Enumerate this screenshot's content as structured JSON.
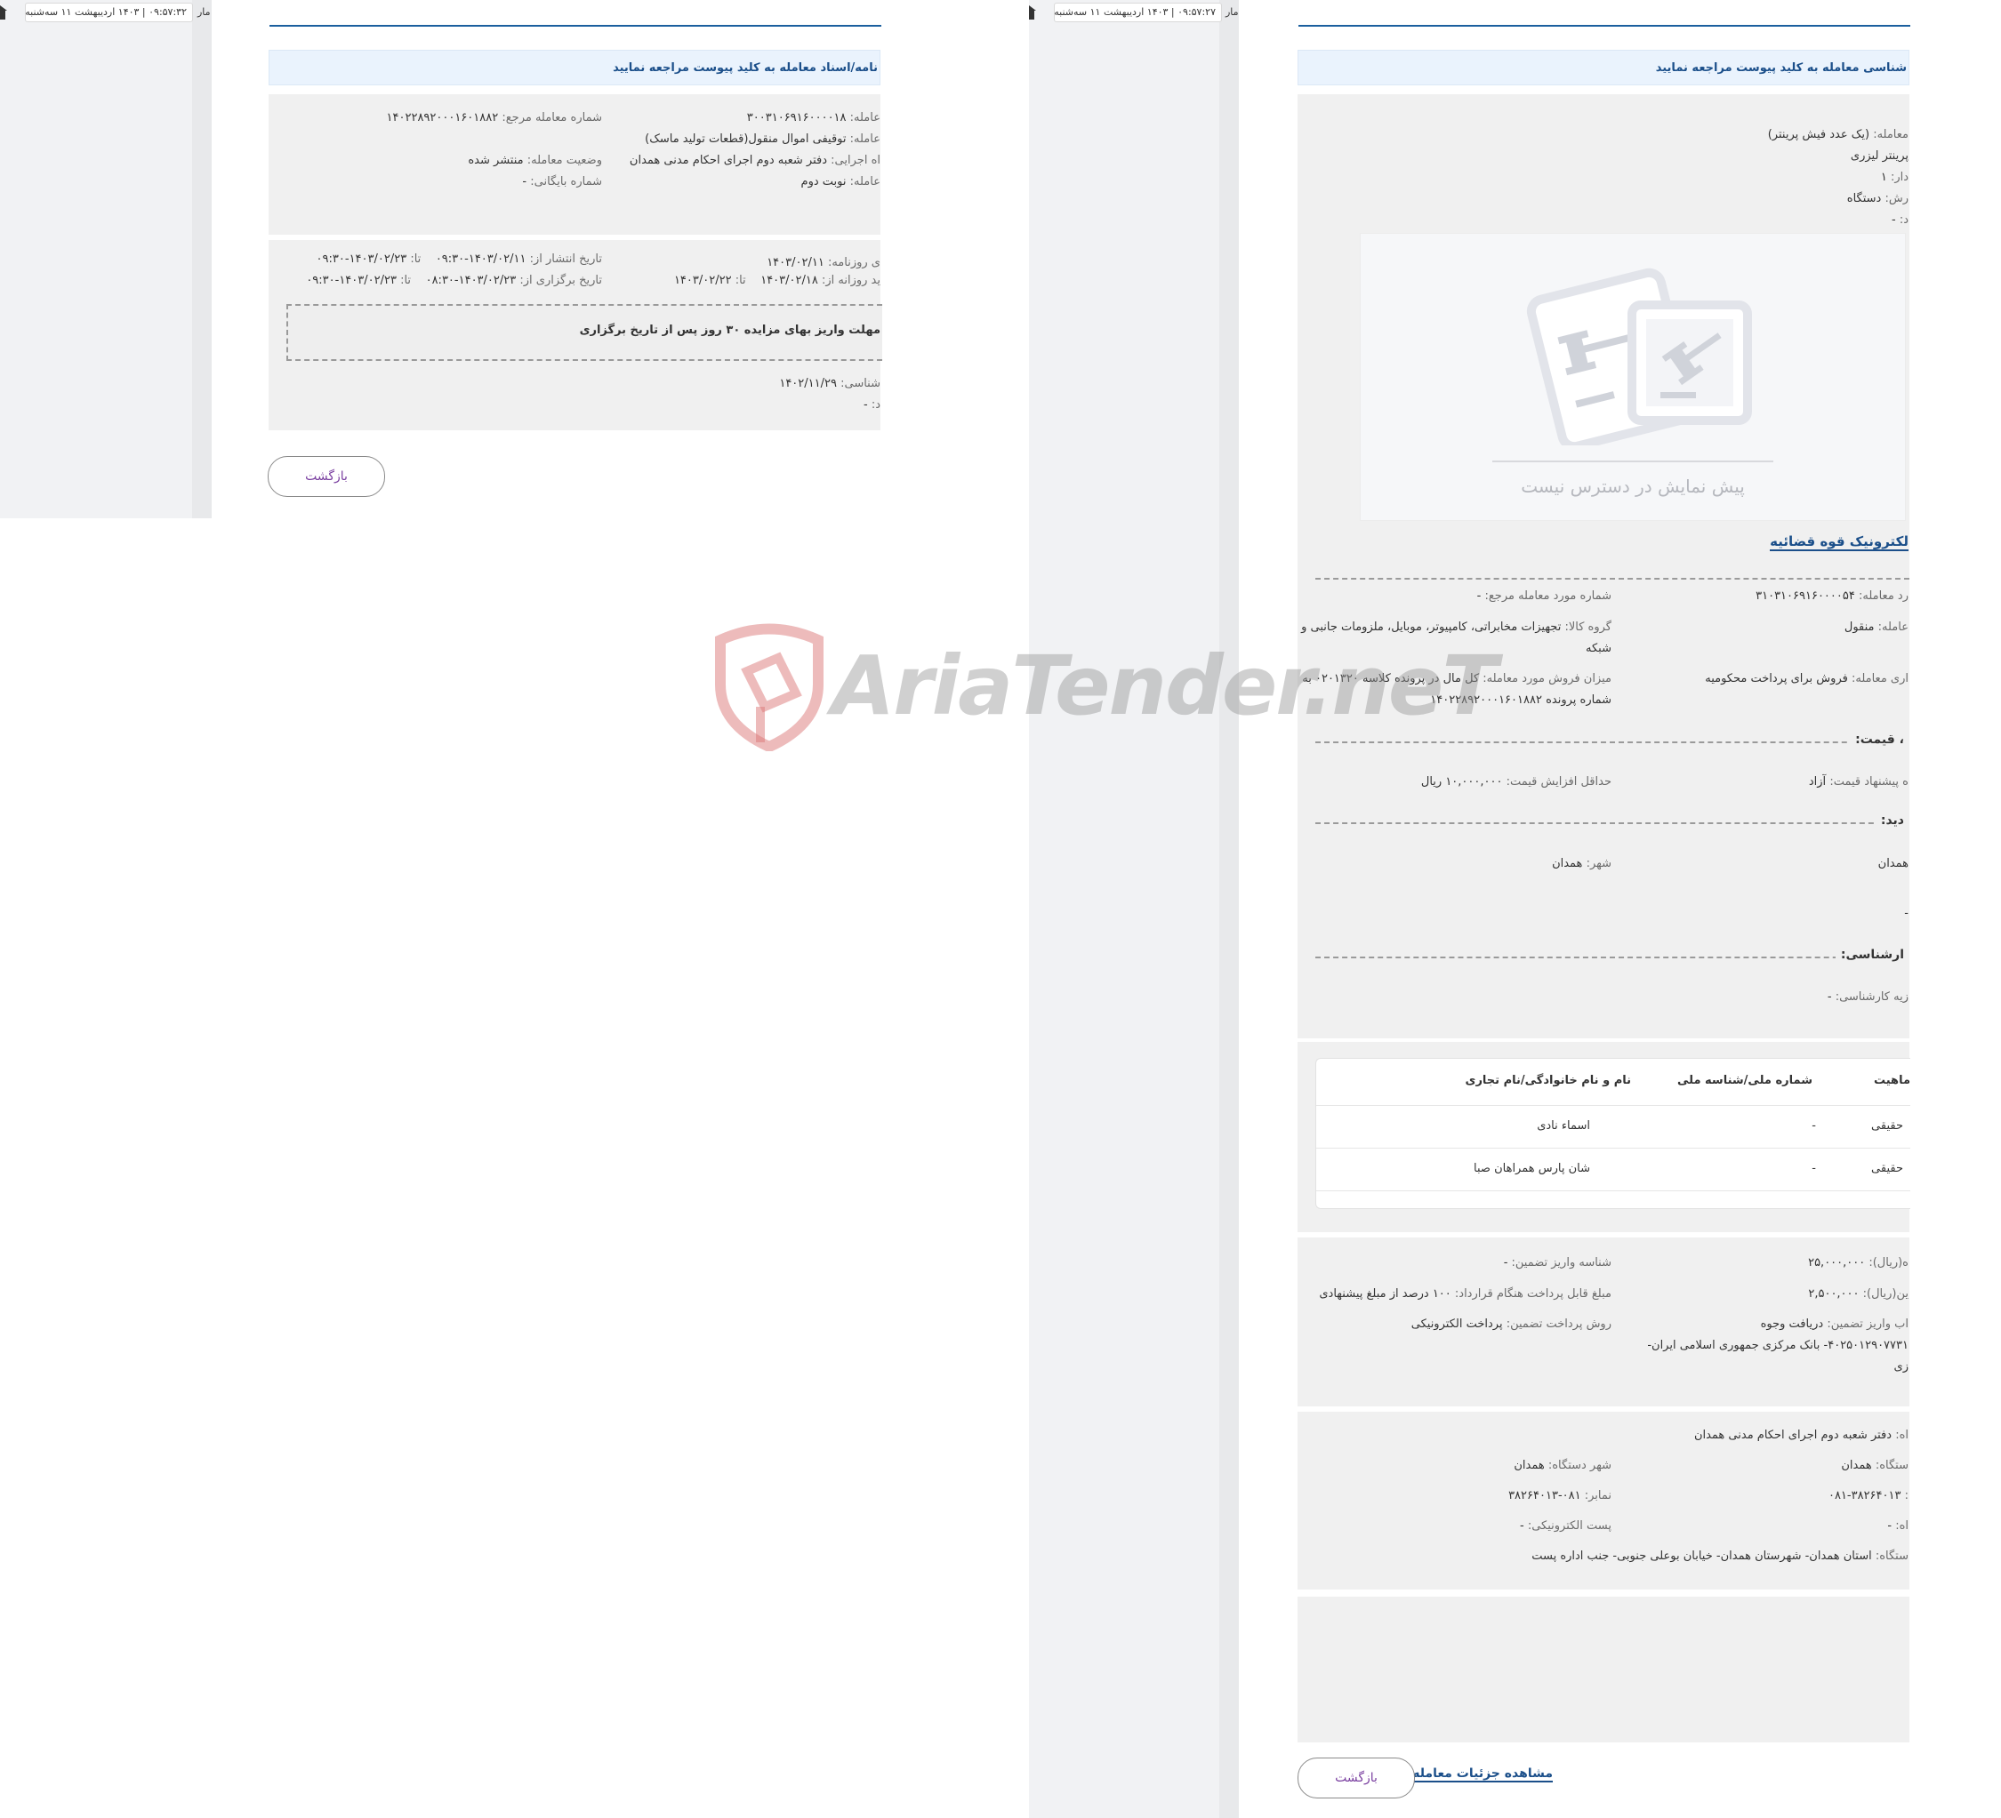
{
  "left_screen": {
    "topbar": {
      "time_date": "۰۹:۵۷:۳۲ | ۱۴۰۳ اردیبهشت ۱۱ سه‌شنبه",
      "partial_label": "مار"
    },
    "notice_text": "نامه/اسناد معامله به کلید پیوست مراجعه نمایید",
    "info": {
      "ref_label": "شماره معامله مرجع:",
      "ref_value": "۱۴۰۲۲۸۹۲۰۰۰۱۶۰۱۸۸۲",
      "deal_no_label": "عامله:",
      "deal_no_value": "۳۰۰۳۱۰۶۹۱۶۰۰۰۰۱۸",
      "deal_title_label": "عامله:",
      "deal_title_value": "توقیفی اموال منقول(قطعات تولید ماسک)",
      "status_label": "وضعیت معامله:",
      "status_value": "منتشر شده",
      "exec_label": "اه اجرایی:",
      "exec_value": "دفتر شعبه دوم اجرای احکام مدنی همدان",
      "archive_label": "شماره بایگانی:",
      "archive_value": "-",
      "round_label": "عامله:",
      "round_value": "نوبت دوم"
    },
    "dates": {
      "newspaper_label": "ی روزنامه:",
      "newspaper_value": "۱۴۰۳/۰۲/۱۱",
      "publish_label": "تاریخ انتشار از:",
      "publish_from": "۱۴۰۳/۰۲/۱۱-۰۹:۳۰",
      "publish_to_label": "تا:",
      "publish_to": "۱۴۰۳/۰۲/۲۳-۰۹:۳۰",
      "visit_label": "ید روزانه از:",
      "visit_from": "۱۴۰۳/۰۲/۱۸",
      "visit_to_label": "تا:",
      "visit_to": "۱۴۰۳/۰۲/۲۲",
      "hold_label": "تاریخ برگزاری از:",
      "hold_from": "۱۴۰۳/۰۲/۲۳-۰۸:۳۰",
      "hold_to_label": "تا:",
      "hold_to": "۱۴۰۳/۰۲/۲۳-۰۹:۳۰",
      "box_text": "مهلت واریز بهای مزایده ۳۰ روز پس از تاریخ برگزاری",
      "expert_label": "شناسی:",
      "expert_value": "۱۴۰۲/۱۱/۲۹",
      "extra_label": "د:",
      "extra_value": "-"
    },
    "back_button": "بازگشت"
  },
  "right_screen": {
    "topbar": {
      "time_date": "۰۹:۵۷:۲۷ | ۱۴۰۳ اردیبهشت ۱۱ سه‌شنبه",
      "partial_label": "مار"
    },
    "notice_text": "شناسی معامله به کلید پیوست مراجعه نمایید",
    "item": {
      "title_label": "معامله:",
      "title_value": "(یک عدد فیش پرینتر)",
      "line2": "پرینتر لیزری",
      "qty_label": "دار:",
      "qty_value": "۱",
      "unit_label": "رش:",
      "unit_value": "دستگاه",
      "extra_label": "د:",
      "extra_value": "-"
    },
    "preview_text": "پیش نمایش در دسترس نیست",
    "judiciary_link": "لکترونیک قوه قضائیه",
    "details": {
      "item_ref_label": "شماره مورد معامله مرجع:",
      "item_ref_value": "-",
      "item_no_label": "رد معامله:",
      "item_no_value": "۳۱۰۳۱۰۶۹۱۶۰۰۰۰۵۴",
      "group_label": "گروه کالا:",
      "group_value": "تجهیزات مخابراتی، کامپیوتر، موبایل، ملزومات جانبی و",
      "group_value_2": "شبکه",
      "type_label": "عامله:",
      "type_value": "منقول",
      "sale_label": "میزان فروش مورد معامله:",
      "sale_value": "کل مال در پرونده کلاسه ۰۲۰۱۳۲۰ به",
      "sale_value_2": "شماره پرونده ۱۴۰۲۲۸۹۲۰۰۰۱۶۰۱۸۸۲",
      "reason_label": "اری معامله:",
      "reason_value": "فروش برای پرداخت محکومیه"
    },
    "price_section": {
      "title": "، قیمت:",
      "min_inc_label": "حداقل افزایش قیمت:",
      "min_inc_value": "۱۰,۰۰۰,۰۰۰ ریال",
      "offer_label": "ه پیشنهاد قیمت:",
      "offer_value": "آزاد"
    },
    "visit_section": {
      "title": "دید:",
      "city_label": "شهر:",
      "city_value": "همدان",
      "province_value": "همدان",
      "dash": "-"
    },
    "expert_section": {
      "title": "ارشناسی:",
      "fee_label": "زیه کارشناسی:",
      "fee_value": "-"
    },
    "table": {
      "headers": [
        "ماهیت",
        "شماره ملی/شناسه ملی",
        "نام و نام خانوادگی/نام تجاری"
      ],
      "rows": [
        [
          "حقیقی",
          "-",
          "اسماء نادی"
        ],
        [
          "حقیقی",
          "-",
          "شان پارس همراهان صبا"
        ]
      ]
    },
    "guarantee": {
      "deposit_id_label": "شناسه واریز تضمین:",
      "deposit_id_value": "-",
      "price_label": "ه(ریال):",
      "price_value": "۲۵,۰۰۰,۰۰۰",
      "contract_label": "مبلغ قابل پرداخت هنگام قرارداد:",
      "contract_value": "۱۰۰ درصد از مبلغ پیشنهادی",
      "guarantee_label": "ین(ریال):",
      "guarantee_value": "۲,۵۰۰,۰۰۰",
      "method_label": "روش پرداخت تضمین:",
      "method_value": "پرداخت الکترونیکی",
      "account_label": "اب واریز تضمین:",
      "account_value": "دریافت وجوه",
      "account_value_2": "۴۰۲۵۰۱۲۹۰۷۷۳۱- بانک مرکزی جمهوری اسلامی ایران-",
      "account_value_3": "زی"
    },
    "office": {
      "org_label": "اه:",
      "org_value": "دفتر شعبه دوم اجرای احکام مدنی همدان",
      "city_label": "شهر دستگاه:",
      "city_value": "همدان",
      "prov_label": "ستگاه:",
      "prov_value": "همدان",
      "fax_label": "نمابر:",
      "fax_value": "۰۸۱-۳۸۲۶۴۰۱۳",
      "tel_label": ":",
      "tel_value": "۰۸۱-۳۸۲۶۴۰۱۳",
      "email_label": "پست الکترونیکی:",
      "email_value": "-",
      "site_label": "اه:",
      "site_value": "-",
      "addr_label": "ستگاه:",
      "addr_value": "استان همدان- شهرستان همدان- خیابان بوعلی جنوبی- جنب اداره پست"
    },
    "details_link": "مشاهده جزئیات معامله",
    "back_button": "بازگشت"
  },
  "watermark": "AriaTender.neT"
}
